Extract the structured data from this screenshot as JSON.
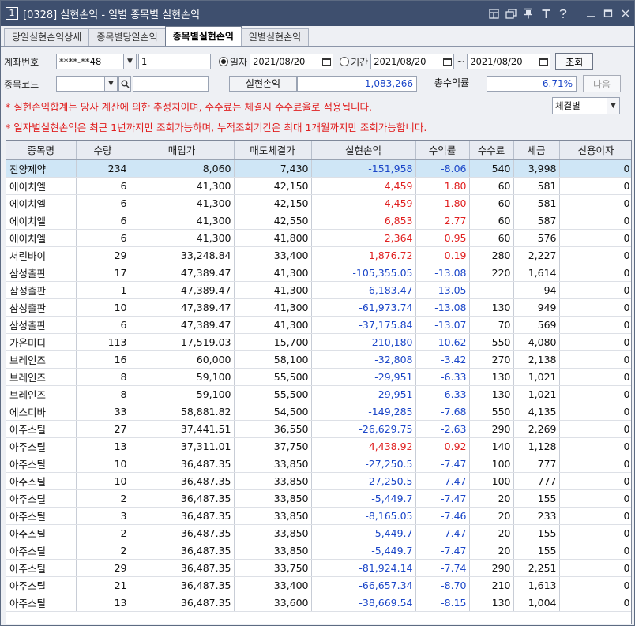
{
  "window": {
    "number": "1",
    "title": "[0328] 실현손익 - 일별 종목별 실현손익",
    "controls": [
      "minimize-icon",
      "close-icon"
    ]
  },
  "tabs": [
    {
      "label": "당일실현손익상세",
      "active": false
    },
    {
      "label": "종목별당일손익",
      "active": false
    },
    {
      "label": "종목별실현손익",
      "active": true
    },
    {
      "label": "일별실현손익",
      "active": false
    }
  ],
  "form": {
    "account_label": "계좌번호",
    "account_value": "****-**48",
    "account_sub": "1",
    "radio_day": "일자",
    "date_day": "2021/08/20",
    "radio_period": "기간",
    "date_from": "2021/08/20",
    "date_sep": "~",
    "date_to": "2021/08/20",
    "query_button": "조회",
    "code_label": "종목코드",
    "code_value": "",
    "code_name": "",
    "realized_label": "실현손익",
    "realized_value": "-1,083,266",
    "rate_label": "총수익률",
    "rate_value": "-6.71%",
    "next_button": "다음",
    "filter_value": "체결별"
  },
  "notices": [
    "* 실현손익합계는 당사 계산에 의한 추정치이며, 수수료는 체결시 수수료율로 적용됩니다.",
    "* 일자별실현손익은 최근 1년까지만 조회가능하며, 누적조회기간은 최대 1개월까지만 조회가능합니다."
  ],
  "table": {
    "headers": [
      "종목명",
      "수량",
      "매입가",
      "매도체결가",
      "실현손익",
      "수익률",
      "수수료",
      "세금",
      "신용이자"
    ],
    "rows": [
      [
        "진양제약",
        "234",
        "8,060",
        "7,430",
        "-151,958",
        "-8.06",
        "540",
        "3,998",
        "0"
      ],
      [
        "에이치엘",
        "6",
        "41,300",
        "42,150",
        "4,459",
        "1.80",
        "60",
        "581",
        "0"
      ],
      [
        "에이치엘",
        "6",
        "41,300",
        "42,150",
        "4,459",
        "1.80",
        "60",
        "581",
        "0"
      ],
      [
        "에이치엘",
        "6",
        "41,300",
        "42,550",
        "6,853",
        "2.77",
        "60",
        "587",
        "0"
      ],
      [
        "에이치엘",
        "6",
        "41,300",
        "41,800",
        "2,364",
        "0.95",
        "60",
        "576",
        "0"
      ],
      [
        "서린바이",
        "29",
        "33,248.84",
        "33,400",
        "1,876.72",
        "0.19",
        "280",
        "2,227",
        "0"
      ],
      [
        "삼성출판",
        "17",
        "47,389.47",
        "41,300",
        "-105,355.05",
        "-13.08",
        "220",
        "1,614",
        "0"
      ],
      [
        "삼성출판",
        "1",
        "47,389.47",
        "41,300",
        "-6,183.47",
        "-13.05",
        "",
        "94",
        "0"
      ],
      [
        "삼성출판",
        "10",
        "47,389.47",
        "41,300",
        "-61,973.74",
        "-13.08",
        "130",
        "949",
        "0"
      ],
      [
        "삼성출판",
        "6",
        "47,389.47",
        "41,300",
        "-37,175.84",
        "-13.07",
        "70",
        "569",
        "0"
      ],
      [
        "가온미디",
        "113",
        "17,519.03",
        "15,700",
        "-210,180",
        "-10.62",
        "550",
        "4,080",
        "0"
      ],
      [
        "브레인즈",
        "16",
        "60,000",
        "58,100",
        "-32,808",
        "-3.42",
        "270",
        "2,138",
        "0"
      ],
      [
        "브레인즈",
        "8",
        "59,100",
        "55,500",
        "-29,951",
        "-6.33",
        "130",
        "1,021",
        "0"
      ],
      [
        "브레인즈",
        "8",
        "59,100",
        "55,500",
        "-29,951",
        "-6.33",
        "130",
        "1,021",
        "0"
      ],
      [
        "에스디바",
        "33",
        "58,881.82",
        "54,500",
        "-149,285",
        "-7.68",
        "550",
        "4,135",
        "0"
      ],
      [
        "아주스틸",
        "27",
        "37,441.51",
        "36,550",
        "-26,629.75",
        "-2.63",
        "290",
        "2,269",
        "0"
      ],
      [
        "아주스틸",
        "13",
        "37,311.01",
        "37,750",
        "4,438.92",
        "0.92",
        "140",
        "1,128",
        "0"
      ],
      [
        "아주스틸",
        "10",
        "36,487.35",
        "33,850",
        "-27,250.5",
        "-7.47",
        "100",
        "777",
        "0"
      ],
      [
        "아주스틸",
        "10",
        "36,487.35",
        "33,850",
        "-27,250.5",
        "-7.47",
        "100",
        "777",
        "0"
      ],
      [
        "아주스틸",
        "2",
        "36,487.35",
        "33,850",
        "-5,449.7",
        "-7.47",
        "20",
        "155",
        "0"
      ],
      [
        "아주스틸",
        "3",
        "36,487.35",
        "33,850",
        "-8,165.05",
        "-7.46",
        "20",
        "233",
        "0"
      ],
      [
        "아주스틸",
        "2",
        "36,487.35",
        "33,850",
        "-5,449.7",
        "-7.47",
        "20",
        "155",
        "0"
      ],
      [
        "아주스틸",
        "2",
        "36,487.35",
        "33,850",
        "-5,449.7",
        "-7.47",
        "20",
        "155",
        "0"
      ],
      [
        "아주스틸",
        "29",
        "36,487.35",
        "33,750",
        "-81,924.14",
        "-7.74",
        "290",
        "2,251",
        "0"
      ],
      [
        "아주스틸",
        "21",
        "36,487.35",
        "33,400",
        "-66,657.34",
        "-8.70",
        "210",
        "1,613",
        "0"
      ],
      [
        "아주스틸",
        "13",
        "36,487.35",
        "33,600",
        "-38,669.54",
        "-8.15",
        "130",
        "1,004",
        "0"
      ]
    ],
    "selected_row": 0
  },
  "colors": {
    "title_bg": "#3e4f6e",
    "negative": "#1b46c8",
    "positive": "#e02020",
    "selected_row": "#cfe6f6"
  }
}
